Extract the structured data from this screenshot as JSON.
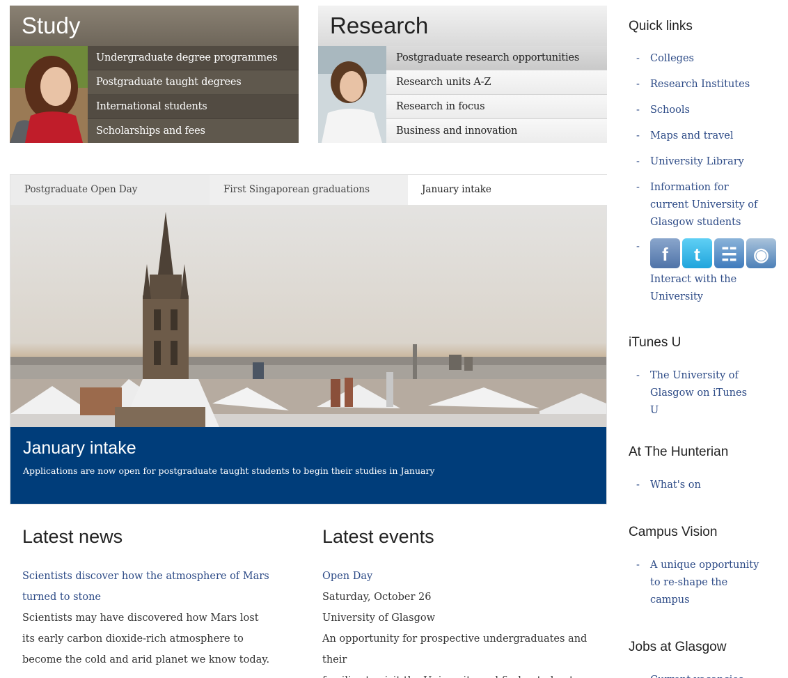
{
  "study": {
    "title": "Study",
    "items": [
      "Undergraduate degree programmes",
      "Postgraduate taught degrees",
      "International students",
      "Scholarships and fees"
    ]
  },
  "research": {
    "title": "Research",
    "items": [
      "Postgraduate research opportunities",
      "Research units A-Z",
      "Research in focus",
      "Business and innovation"
    ]
  },
  "feature": {
    "tabs": [
      "Postgraduate Open Day",
      "First Singaporean graduations",
      "January intake"
    ],
    "active_tab": "January intake",
    "caption_title": "January intake",
    "caption_text": "Applications are now open for postgraduate taught students to begin their studies in January"
  },
  "news": {
    "heading": "Latest news",
    "item_title_line1": "Scientists discover how the atmosphere of Mars",
    "item_title_line2": "turned to stone",
    "item_text": [
      "Scientists may have discovered how Mars lost",
      "its early carbon dioxide-rich atmosphere to",
      "become the cold and arid planet we know today."
    ]
  },
  "events": {
    "heading": "Latest events",
    "item_title": "Open Day",
    "date": "Saturday, October 26",
    "location": "University of Glasgow",
    "text": [
      "An opportunity for prospective undergraduates and their",
      "families to visit the University and find out about"
    ]
  },
  "sidebar": {
    "quick_links": {
      "heading": "Quick links",
      "items": [
        "Colleges",
        "Research Institutes",
        "Schools",
        "Maps and travel",
        "University Library",
        "Information for current University of Glasgow students"
      ],
      "interact_label": "Interact with the University",
      "social_icons": [
        "facebook-icon",
        "twitter-icon",
        "rss-icon",
        "weibo-icon"
      ]
    },
    "itunes": {
      "heading": "iTunes U",
      "items": [
        "The University of Glasgow on iTunes U"
      ]
    },
    "hunterian": {
      "heading": "At The Hunterian",
      "items": [
        "What's on"
      ]
    },
    "campus": {
      "heading": "Campus Vision",
      "items": [
        "A unique opportunity to re-shape the campus"
      ]
    },
    "jobs": {
      "heading": "Jobs at Glasgow",
      "items": [
        "Current vacancies"
      ]
    }
  },
  "colors": {
    "caption_bg": "#003d7a",
    "link": "#2c4a86",
    "study_bg": "#5c554b"
  }
}
